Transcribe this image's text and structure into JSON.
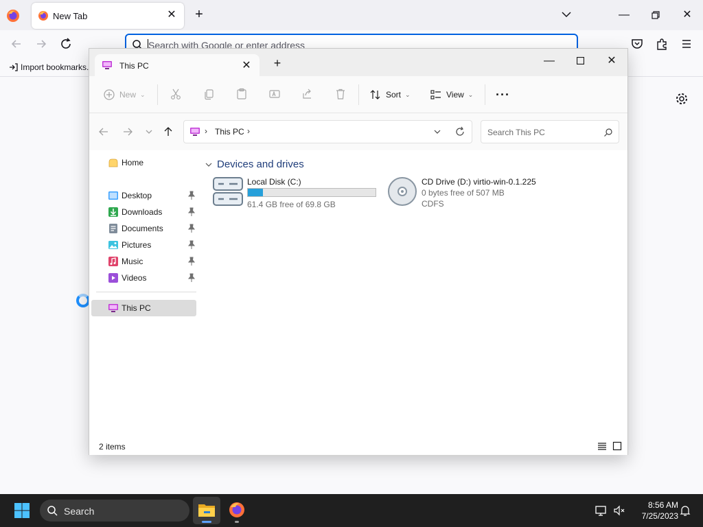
{
  "firefox": {
    "tab_title": "New Tab",
    "url_placeholder": "Search with Google or enter address",
    "bookmarks_import_label": "Import bookmarks..."
  },
  "explorer": {
    "tab_title": "This PC",
    "toolbar": {
      "new_label": "New",
      "sort_label": "Sort",
      "view_label": "View",
      "more_label": "···"
    },
    "address": {
      "location": "This PC",
      "search_placeholder": "Search This PC"
    },
    "nav": {
      "home": "Home",
      "items": [
        {
          "label": "Desktop",
          "icon": "desktop-icon",
          "color": "#3aa0ff"
        },
        {
          "label": "Downloads",
          "icon": "downloads-icon",
          "color": "#2fa84f"
        },
        {
          "label": "Documents",
          "icon": "documents-icon",
          "color": "#7f8c9a"
        },
        {
          "label": "Pictures",
          "icon": "pictures-icon",
          "color": "#3cc3e0"
        },
        {
          "label": "Music",
          "icon": "music-icon",
          "color": "#e0436b"
        },
        {
          "label": "Videos",
          "icon": "videos-icon",
          "color": "#9b4fd9"
        }
      ],
      "this_pc": "This PC"
    },
    "group_header": "Devices and drives",
    "drives": [
      {
        "name": "Local Disk (C:)",
        "space": "61.4 GB free of 69.8 GB",
        "used_fraction": 0.12
      },
      {
        "name": "CD Drive (D:) virtio-win-0.1.225",
        "space": "0 bytes free of 507 MB",
        "fs": "CDFS"
      }
    ],
    "status": "2 items"
  },
  "taskbar": {
    "search_label": "Search",
    "time": "8:56 AM",
    "date": "7/25/2023"
  },
  "colors": {
    "accent": "#0061e0",
    "drive_bar": "#26a0da",
    "taskbar": "#1f1f1f"
  }
}
